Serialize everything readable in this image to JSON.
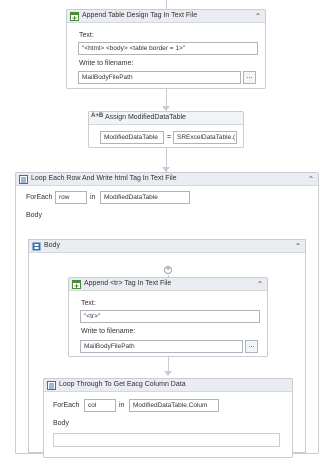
{
  "append_design": {
    "title": "Append Table Design Tag In Text  File",
    "text_label": "Text:",
    "text_value": "\"<html> <body> <table border = 1>\"",
    "file_label": "Write to filename:",
    "file_value": "MailBodyFilePath",
    "browse_label": "..."
  },
  "assign": {
    "title": "Assign ModifiedDataTable",
    "left_value": "ModifiedDataTable",
    "operator": "=",
    "right_value": "SRExcelDataTable.("
  },
  "loop_rows": {
    "title": "Loop Each Row And Write html Tag In Text  File",
    "foreach_label": "ForEach",
    "item_value": "row",
    "in_label": "in",
    "collection_value": "ModifiedDataTable",
    "body_label": "Body"
  },
  "inner_body": {
    "title": "Body"
  },
  "append_tr": {
    "title": "Append <tr> Tag In Text  File",
    "text_label": "Text:",
    "text_value": "\"<tr>\"",
    "file_label": "Write to filename:",
    "file_value": "MailBodyFilePath",
    "browse_label": "..."
  },
  "loop_cols": {
    "title": "Loop Through To Get Eacg Column Data",
    "foreach_label": "ForEach",
    "item_value": "col",
    "in_label": "in",
    "collection_value": "ModifiedDataTable.Colum",
    "body_label": "Body"
  },
  "icons": {
    "collapse": "double-chevron-up-icon",
    "add": "plus-circle-icon"
  }
}
